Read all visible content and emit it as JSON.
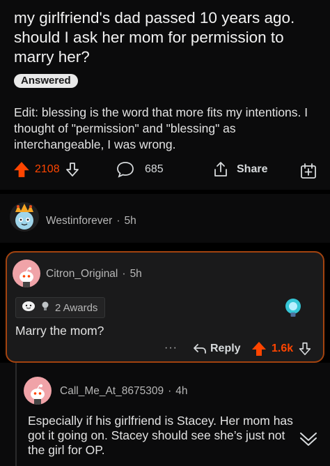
{
  "post": {
    "title": "my girlfriend's dad passed 10 years ago. should I ask her mom for permission to marry her?",
    "flair": "Answered",
    "body": "Edit: blessing is the word that more fits my intentions. I thought of \"permission\" and \"blessing\" as interchangeable, I was wrong.",
    "upvotes": "2108",
    "comments": "685",
    "share_label": "Share"
  },
  "comments": [
    {
      "user": "Westinforever",
      "time": "5h"
    },
    {
      "user": "Citron_Original",
      "time": "5h",
      "awards": "2 Awards",
      "text": "Marry the mom?",
      "reply_label": "Reply",
      "score": "1.6k",
      "more": "···"
    },
    {
      "user": "Call_Me_At_8675309",
      "time": "4h",
      "text": "Especially if his girlfriend is Stacey.  Her mom has got it going on. Stacey should see she’s just not the girl for OP."
    }
  ],
  "colors": {
    "upvote": "#ff4500",
    "highlight_border": "#a3430f"
  },
  "icons": [
    "upvote-icon",
    "downvote-icon",
    "comment-icon",
    "share-icon",
    "save-icon",
    "reply-icon",
    "lightbulb-award-icon",
    "collapse-chevron-icon"
  ]
}
